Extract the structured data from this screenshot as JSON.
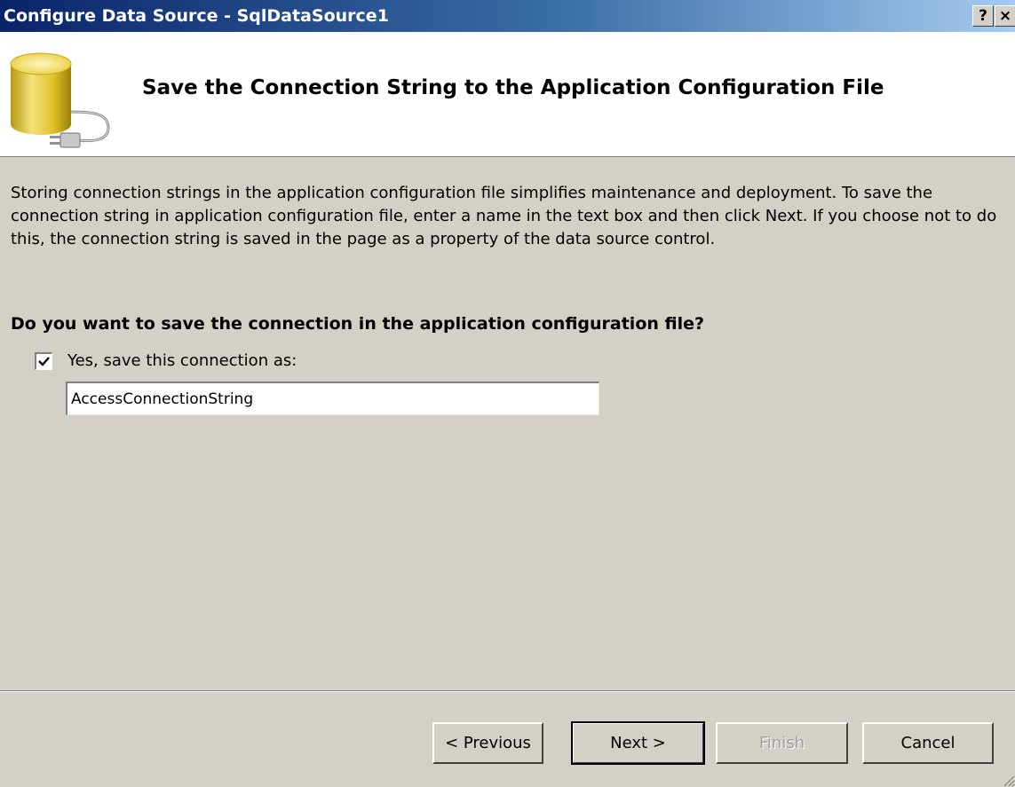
{
  "window": {
    "title": "Configure Data Source - SqlDataSource1",
    "help_label": "?",
    "close_label": "×"
  },
  "banner": {
    "icon": "database-plug-icon",
    "title": "Save the Connection String to the Application Configuration File"
  },
  "body": {
    "description": "Storing connection strings in the application configuration file simplifies maintenance and deployment. To save the connection string in application configuration file, enter a name in the text box and then click Next. If you choose not to do this, the connection string is saved in the page as a property of the data source control.",
    "question": "Do you want to save the connection in the application configuration file?",
    "save_checkbox": {
      "label": "Yes, save this connection as:",
      "checked": true
    },
    "connection_name": "AccessConnectionString"
  },
  "buttons": {
    "previous": "< Previous",
    "next": "Next >",
    "finish": "Finish",
    "cancel": "Cancel"
  }
}
